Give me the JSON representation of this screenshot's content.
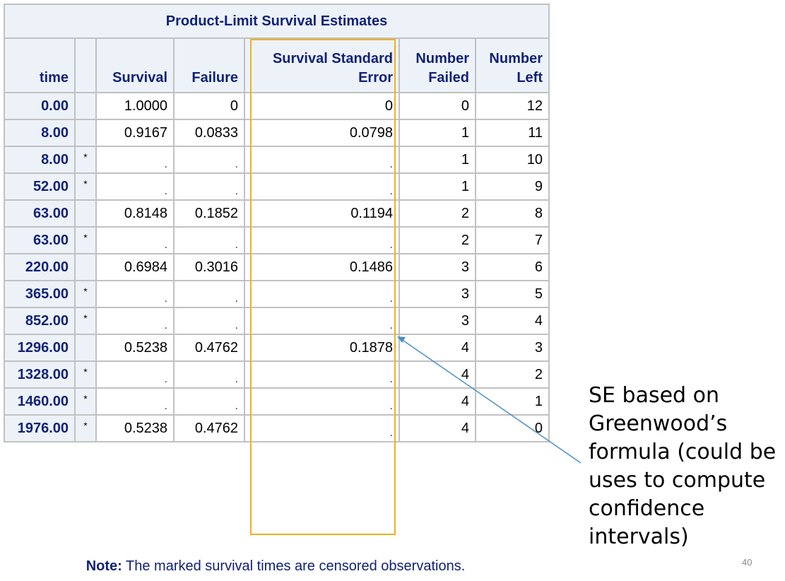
{
  "table": {
    "title": "Product-Limit Survival Estimates",
    "columns": [
      "time",
      "",
      "Survival",
      "Failure",
      "Survival Standard Error",
      "Number Failed",
      "Number Left"
    ],
    "header_lines": {
      "time": "time",
      "survival": "Survival",
      "failure": "Failure",
      "sse_line1": "Survival Standard",
      "sse_line2": "Error",
      "failed_line1": "Number",
      "failed_line2": "Failed",
      "left_line1": "Number",
      "left_line2": "Left"
    },
    "rows": [
      {
        "time": "0.00",
        "censored": "",
        "survival": "1.0000",
        "failure": "0",
        "sse": "0",
        "failed": "0",
        "left": "12"
      },
      {
        "time": "8.00",
        "censored": "",
        "survival": "0.9167",
        "failure": "0.0833",
        "sse": "0.0798",
        "failed": "1",
        "left": "11"
      },
      {
        "time": "8.00",
        "censored": "*",
        "survival": ".",
        "failure": ".",
        "sse": ".",
        "failed": "1",
        "left": "10"
      },
      {
        "time": "52.00",
        "censored": "*",
        "survival": ".",
        "failure": ".",
        "sse": ".",
        "failed": "1",
        "left": "9"
      },
      {
        "time": "63.00",
        "censored": "",
        "survival": "0.8148",
        "failure": "0.1852",
        "sse": "0.1194",
        "failed": "2",
        "left": "8"
      },
      {
        "time": "63.00",
        "censored": "*",
        "survival": ".",
        "failure": ".",
        "sse": ".",
        "failed": "2",
        "left": "7"
      },
      {
        "time": "220.00",
        "censored": "",
        "survival": "0.6984",
        "failure": "0.3016",
        "sse": "0.1486",
        "failed": "3",
        "left": "6"
      },
      {
        "time": "365.00",
        "censored": "*",
        "survival": ".",
        "failure": ".",
        "sse": ".",
        "failed": "3",
        "left": "5"
      },
      {
        "time": "852.00",
        "censored": "*",
        "survival": ".",
        "failure": ".",
        "sse": ".",
        "failed": "3",
        "left": "4"
      },
      {
        "time": "1296.00",
        "censored": "",
        "survival": "0.5238",
        "failure": "0.4762",
        "sse": "0.1878",
        "failed": "4",
        "left": "3"
      },
      {
        "time": "1328.00",
        "censored": "*",
        "survival": ".",
        "failure": ".",
        "sse": ".",
        "failed": "4",
        "left": "2"
      },
      {
        "time": "1460.00",
        "censored": "*",
        "survival": ".",
        "failure": ".",
        "sse": ".",
        "failed": "4",
        "left": "1"
      },
      {
        "time": "1976.00",
        "censored": "*",
        "survival": "0.5238",
        "failure": "0.4762",
        "sse": ".",
        "failed": "4",
        "left": "0"
      }
    ]
  },
  "note": {
    "label": "Note:",
    "text": " The marked survival times are censored observations."
  },
  "callout": {
    "lines": [
      "SE based on",
      "Greenwood’s",
      "formula (could be",
      "uses to compute",
      "confidence",
      "intervals)"
    ]
  },
  "slide_number": "40",
  "colors": {
    "header_bg": "#edf2f9",
    "header_text": "#112277",
    "grid": "#c1c1c1",
    "highlight": "#f0b020",
    "arrow": "#4a90c8"
  }
}
